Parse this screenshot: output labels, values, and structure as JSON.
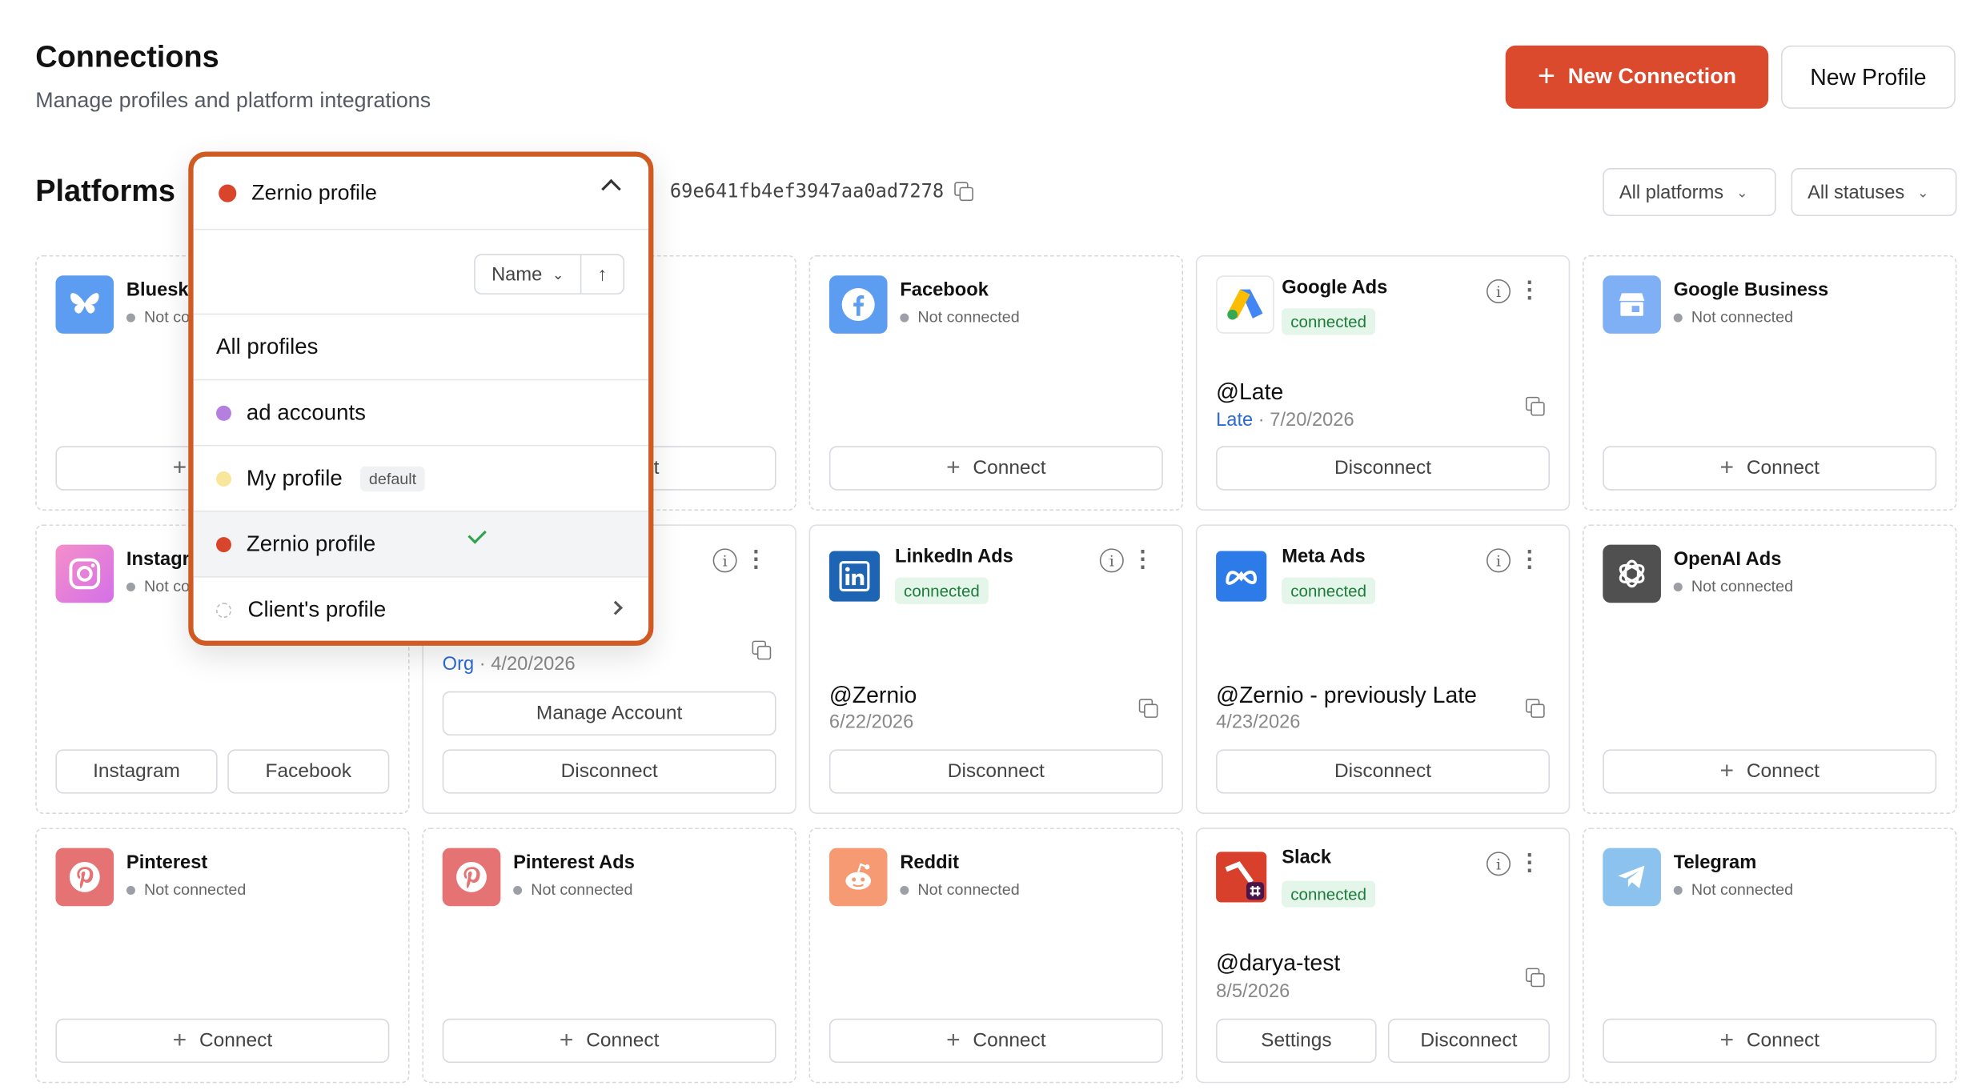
{
  "header": {
    "title": "Connections",
    "subtitle": "Manage profiles and platform integrations",
    "new_connection_label": "New Connection",
    "new_profile_label": "New Profile"
  },
  "platforms_section": {
    "title": "Platforms",
    "profile_id": "69e641fb4ef3947aa0ad7278",
    "filter_platforms": "All platforms",
    "filter_statuses": "All statuses"
  },
  "profile_dropdown": {
    "selected": "Zernio profile",
    "selected_color": "#d9452b",
    "sort_label": "Name",
    "all_profiles": "All profiles",
    "items": [
      {
        "label": "ad accounts",
        "color": "#b57fe0"
      },
      {
        "label": "My profile",
        "color": "#f8e69a",
        "tag": "default"
      },
      {
        "label": "Zernio profile",
        "color": "#d9452b"
      },
      {
        "label": "Client's profile",
        "color": "none"
      }
    ]
  },
  "labels": {
    "connect": "Connect",
    "disconnect": "Disconnect",
    "not_connected": "Not connected",
    "connected": "connected",
    "manage_account": "Manage Account",
    "settings": "Settings",
    "instagram_btn": "Instagram",
    "facebook_btn": "Facebook",
    "org": "Org",
    "late": "Late"
  },
  "cards": {
    "bluesky": {
      "name": "Bluesky"
    },
    "facebook": {
      "name": "Facebook"
    },
    "google_ads": {
      "name": "Google Ads",
      "handle": "@Late",
      "date": "7/20/2026"
    },
    "google_business": {
      "name": "Google Business"
    },
    "instagram": {
      "name": "Instagram"
    },
    "linkedin": {
      "date": "4/20/2026"
    },
    "linkedin_ads": {
      "name": "LinkedIn Ads",
      "handle": "@Zernio",
      "date": "6/22/2026"
    },
    "meta_ads": {
      "name": "Meta Ads",
      "handle": "@Zernio - previously Late",
      "date": "4/23/2026"
    },
    "openai_ads": {
      "name": "OpenAI Ads"
    },
    "pinterest": {
      "name": "Pinterest"
    },
    "pinterest_ads": {
      "name": "Pinterest Ads"
    },
    "reddit": {
      "name": "Reddit"
    },
    "slack": {
      "name": "Slack",
      "handle": "@darya-test",
      "date": "8/5/2026"
    },
    "telegram": {
      "name": "Telegram"
    }
  }
}
